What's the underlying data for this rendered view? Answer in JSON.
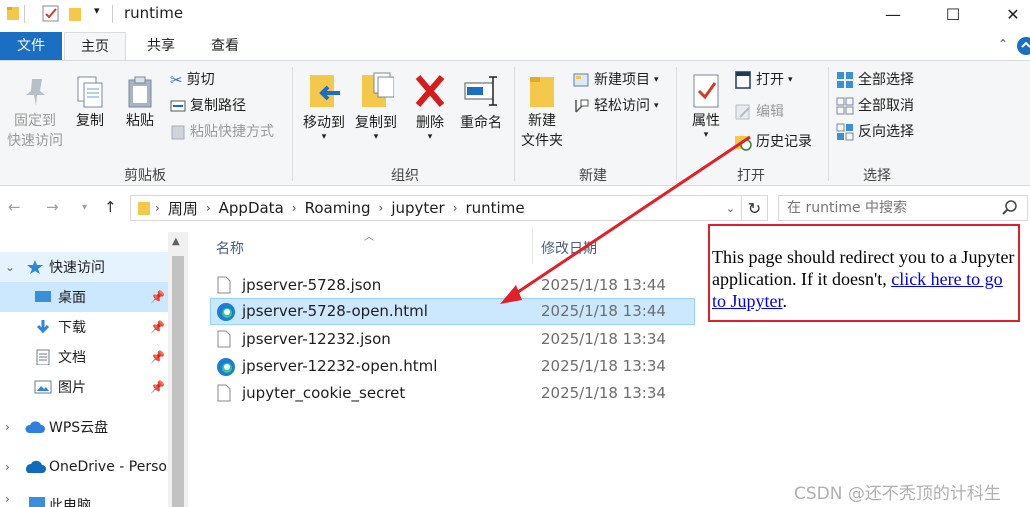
{
  "window": {
    "title": "runtime",
    "minimize_glyph": "—",
    "maximize_glyph": "☐",
    "close_glyph": "✕"
  },
  "tabs": [
    "文件",
    "主页",
    "共享",
    "查看"
  ],
  "ribbon": {
    "clipboard": {
      "pin_quick_access": [
        "固定到",
        "快速访问"
      ],
      "copy": "复制",
      "paste": "粘贴",
      "cut": "剪切",
      "copy_path": "复制路径",
      "paste_shortcut": "粘贴快捷方式",
      "label": "剪贴板"
    },
    "organize": {
      "move_to": "移动到",
      "copy_to": "复制到",
      "delete": "删除",
      "rename": "重命名",
      "label": "组织"
    },
    "new": {
      "new_folder": [
        "新建",
        "文件夹"
      ],
      "new_item": "新建项目",
      "easy_access": "轻松访问",
      "label": "新建"
    },
    "open": {
      "properties": "属性",
      "open": "打开",
      "edit": "编辑",
      "history": "历史记录",
      "label": "打开"
    },
    "select": {
      "select_all": "全部选择",
      "select_none": "全部取消",
      "invert": "反向选择",
      "label": "选择"
    }
  },
  "address": {
    "crumbs": [
      "周周",
      "AppData",
      "Roaming",
      "jupyter",
      "runtime"
    ],
    "search_placeholder": "在 runtime 中搜索"
  },
  "sidebar": {
    "items": [
      {
        "label": "快速访问",
        "icon": "star-icon"
      },
      {
        "label": "桌面",
        "icon": "desktop-icon"
      },
      {
        "label": "下载",
        "icon": "download-icon"
      },
      {
        "label": "文档",
        "icon": "document-icon"
      },
      {
        "label": "图片",
        "icon": "pictures-icon"
      },
      {
        "label": "WPS云盘",
        "icon": "cloud-icon"
      },
      {
        "label": "OneDrive - Perso",
        "icon": "onedrive-icon"
      },
      {
        "label": "此电脑",
        "icon": "computer-icon"
      }
    ]
  },
  "filelist": {
    "columns": {
      "name": "名称",
      "modified": "修改日期"
    },
    "rows": [
      {
        "name": "jpserver-5728.json",
        "date": "2025/1/18 13:44",
        "icon": "file-icon"
      },
      {
        "name": "jpserver-5728-open.html",
        "date": "2025/1/18 13:44",
        "icon": "edge-icon"
      },
      {
        "name": "jpserver-12232.json",
        "date": "2025/1/18 13:34",
        "icon": "file-icon"
      },
      {
        "name": "jpserver-12232-open.html",
        "date": "2025/1/18 13:34",
        "icon": "edge-icon"
      },
      {
        "name": "jupyter_cookie_secret",
        "date": "2025/1/18 13:34",
        "icon": "file-icon"
      }
    ]
  },
  "preview": {
    "text_before": "This page should redirect you to a Jupyter application. If it doesn't, ",
    "link_text": "click here to go to Jupyter",
    "text_after": "."
  },
  "watermark": "CSDN @还不秃顶的计科生",
  "colors": {
    "accent": "#1a6fc2",
    "selection": "#cce8ff",
    "highlight_box": "#e0202a",
    "link": "#0000ee"
  }
}
